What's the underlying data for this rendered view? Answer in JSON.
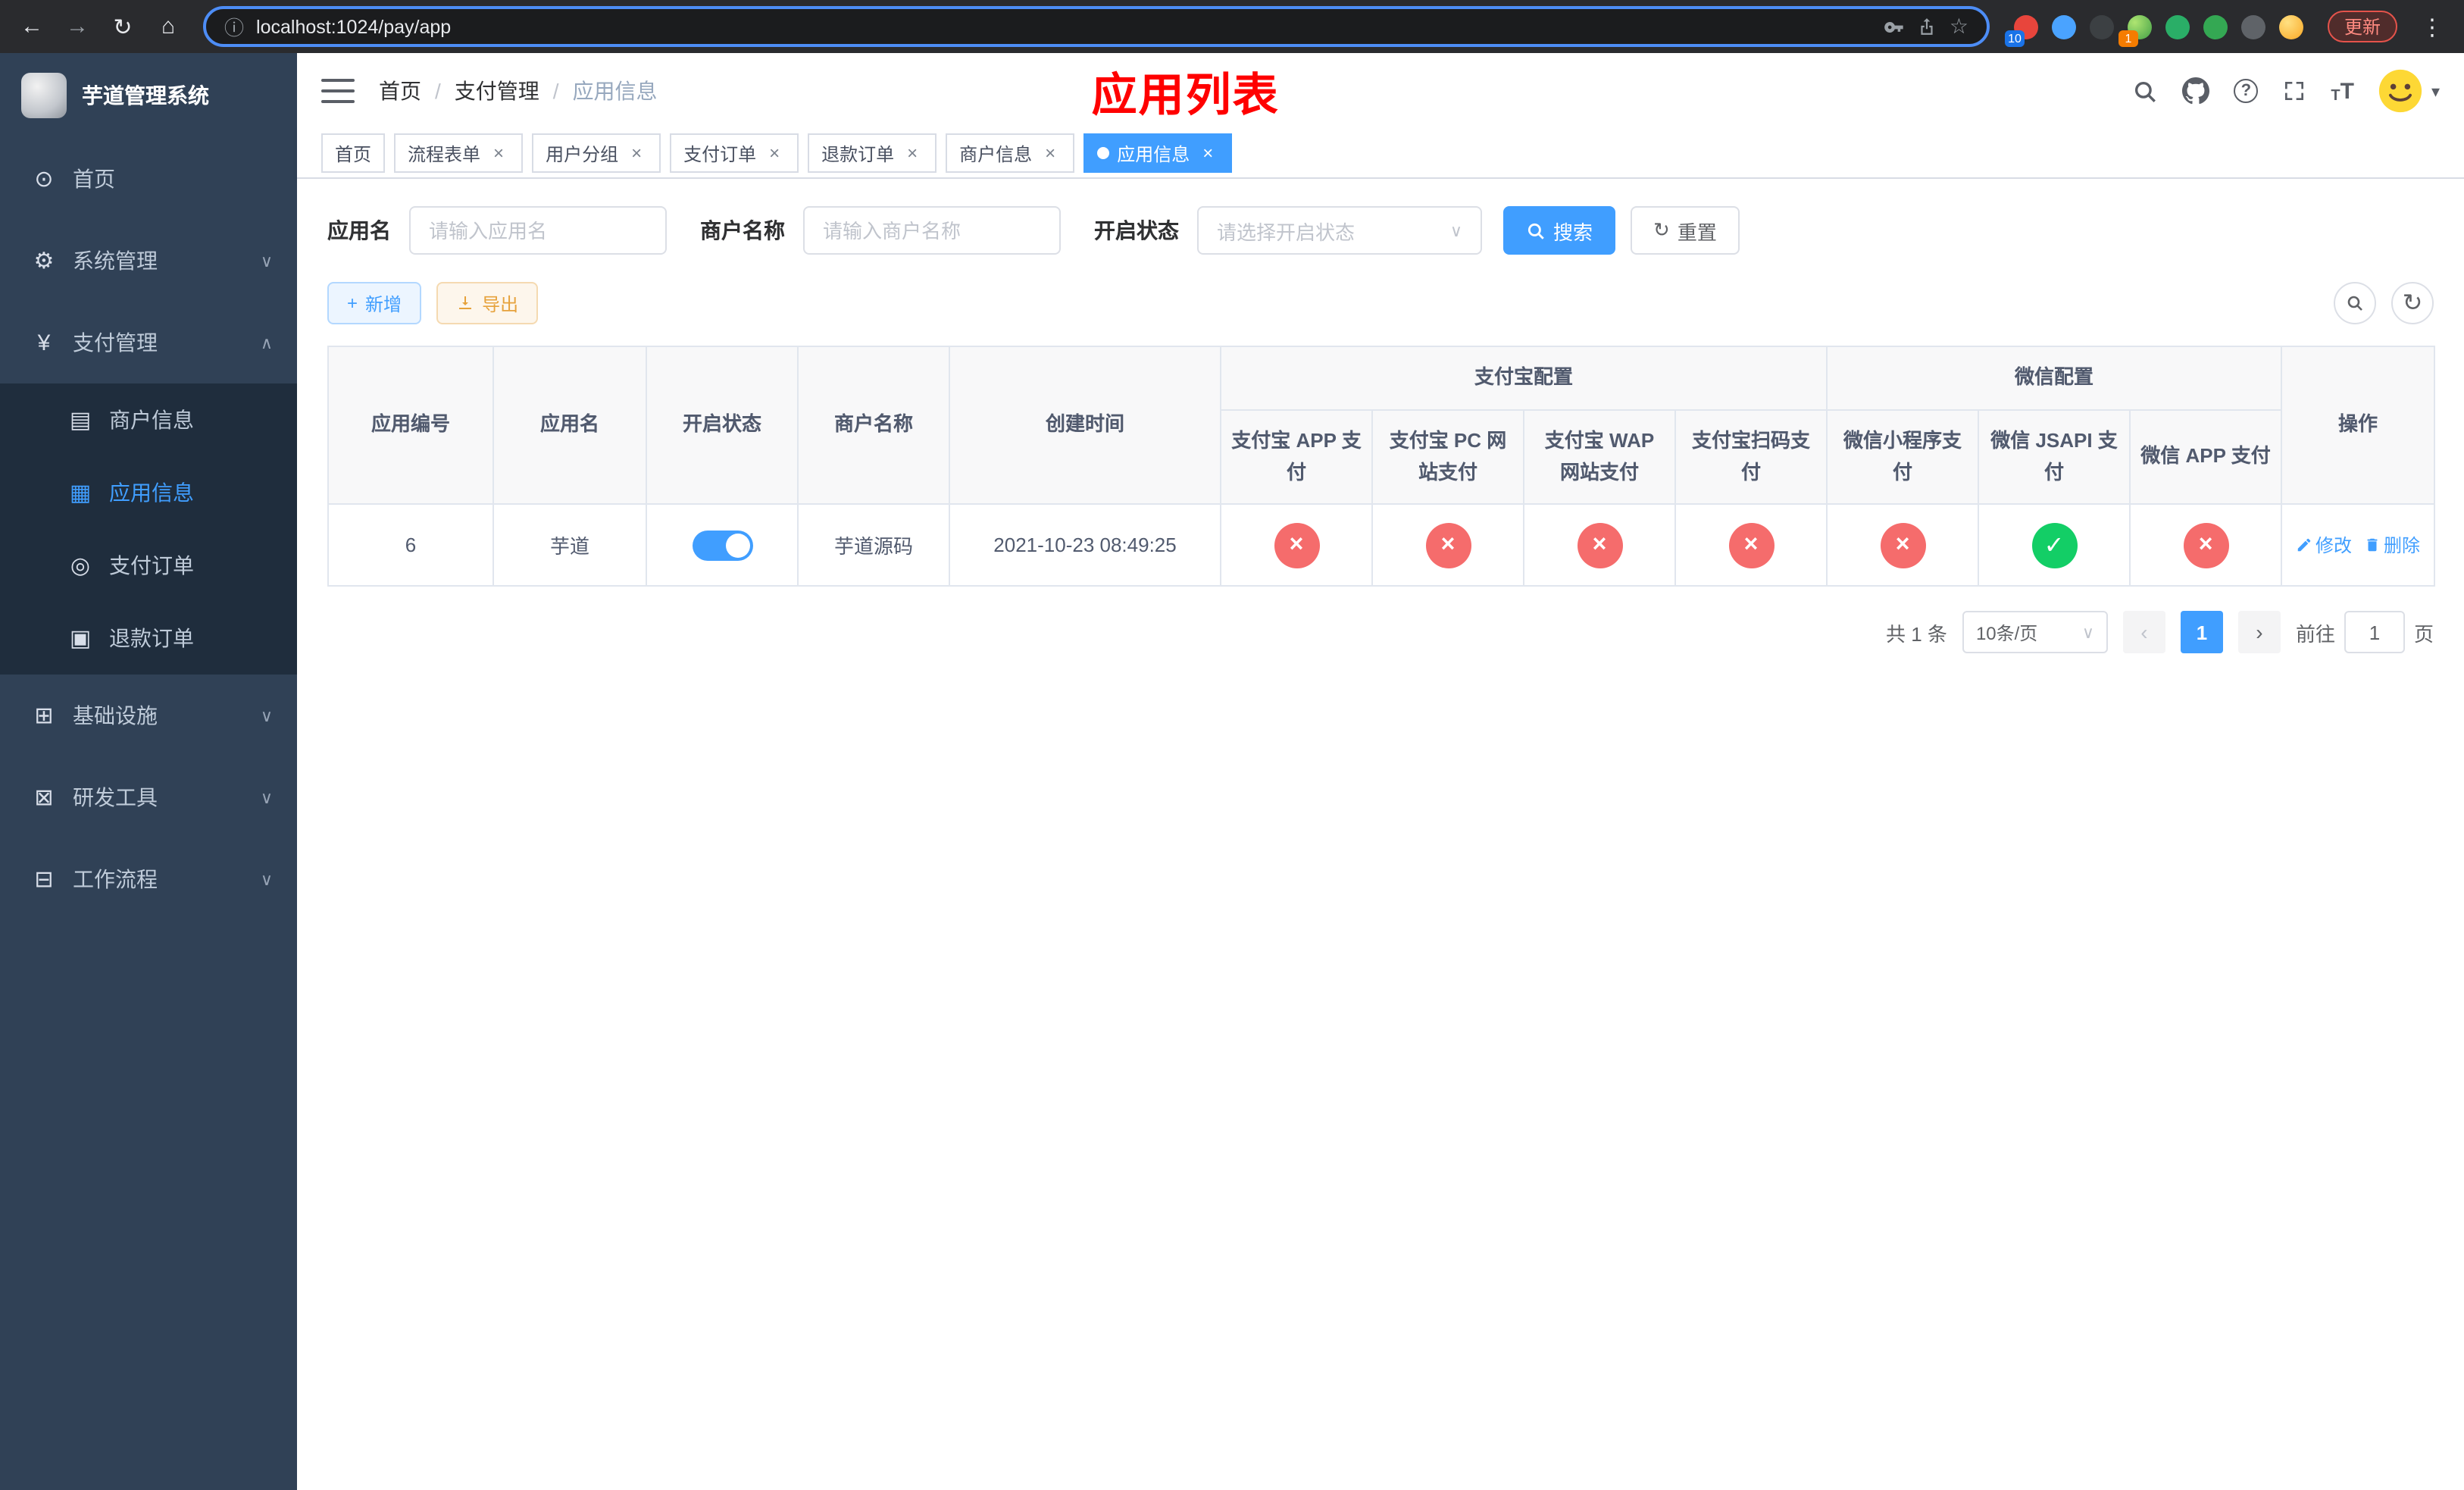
{
  "browser": {
    "url": "localhost:1024/pay/app",
    "update_label": "更新",
    "ext_badge_1": "10",
    "ext_badge_2": "1"
  },
  "icons": {
    "back": "←",
    "forward": "→",
    "reload": "↻",
    "home": "⌂",
    "info": "ⓘ",
    "star": "☆",
    "menu": "⋮",
    "help": "?",
    "chevron_down": "∨",
    "chevron_up": "∧",
    "dashboard": "⊙",
    "gear": "⚙",
    "yen": "¥",
    "card": "▤",
    "grid": "▦",
    "order": "◎",
    "refund": "▣",
    "infra": "⊞",
    "tool": "⊠",
    "flow": "⊟",
    "caret_down": "▾",
    "select_caret": "∨",
    "prev": "‹",
    "next": "›",
    "plus": "+",
    "close": "×",
    "text_size": "T"
  },
  "sidebar": {
    "title": "芋道管理系统",
    "items": [
      {
        "label": "首页"
      },
      {
        "label": "系统管理"
      },
      {
        "label": "支付管理",
        "children": [
          {
            "label": "商户信息"
          },
          {
            "label": "应用信息"
          },
          {
            "label": "支付订单"
          },
          {
            "label": "退款订单"
          }
        ]
      },
      {
        "label": "基础设施"
      },
      {
        "label": "研发工具"
      },
      {
        "label": "工作流程"
      }
    ]
  },
  "header": {
    "breadcrumb": [
      "首页",
      "支付管理",
      "应用信息"
    ],
    "overlay_title": "应用列表"
  },
  "tags": [
    {
      "label": "首页"
    },
    {
      "label": "流程表单"
    },
    {
      "label": "用户分组"
    },
    {
      "label": "支付订单"
    },
    {
      "label": "退款订单"
    },
    {
      "label": "商户信息"
    },
    {
      "label": "应用信息"
    }
  ],
  "filters": {
    "app_name": {
      "label": "应用名",
      "placeholder": "请输入应用名",
      "value": ""
    },
    "merchant_name": {
      "label": "商户名称",
      "placeholder": "请输入商户名称",
      "value": ""
    },
    "status": {
      "label": "开启状态",
      "placeholder": "请选择开启状态"
    },
    "search_label": "搜索",
    "reset_label": "重置"
  },
  "toolbar": {
    "add_label": "新增",
    "export_label": "导出"
  },
  "table": {
    "columns": {
      "app_id": "应用编号",
      "app_name": "应用名",
      "status": "开启状态",
      "merchant": "商户名称",
      "created": "创建时间",
      "alipay_group": "支付宝配置",
      "wechat_group": "微信配置",
      "alipay": [
        "支付宝 APP 支付",
        "支付宝 PC 网站支付",
        "支付宝 WAP 网站支付",
        "支付宝扫码支付"
      ],
      "wechat": [
        "微信小程序支付",
        "微信 JSAPI 支付",
        "微信 APP 支付"
      ],
      "actions": "操作"
    },
    "rows": [
      {
        "app_id": "6",
        "app_name": "芋道",
        "enabled": true,
        "merchant": "芋道源码",
        "created": "2021-10-23 08:49:25",
        "alipay": [
          "no",
          "no",
          "no",
          "no"
        ],
        "wechat": [
          "no",
          "yes",
          "no"
        ],
        "edit_label": "修改",
        "delete_label": "删除"
      }
    ]
  },
  "pagination": {
    "total": "共 1 条",
    "page_size": "10条/页",
    "current_page": "1",
    "goto_label": "前往",
    "goto_value": "1",
    "unit_label": "页"
  }
}
